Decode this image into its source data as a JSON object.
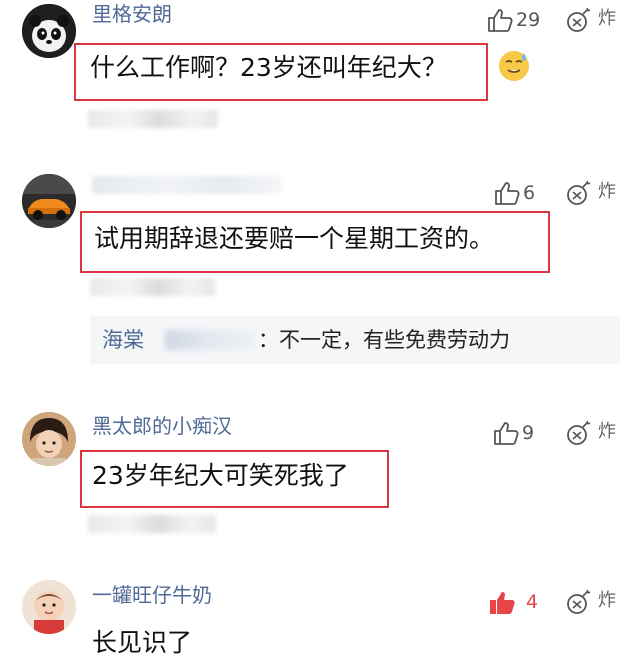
{
  "comments": [
    {
      "username": "里格安朗",
      "likes": "29",
      "bomb_label": "炸",
      "text": "什么工作啊？23岁还叫年纪大？",
      "emoji": "sweat-smile-emoji"
    },
    {
      "username": "",
      "likes": "6",
      "bomb_label": "炸",
      "text": "试用期辞退还要赔一个星期工资的。",
      "reply": {
        "user": "海棠",
        "separator": "：",
        "text": "不一定，有些免费劳动力"
      }
    },
    {
      "username": "黑太郎的小痴汉",
      "likes": "9",
      "bomb_label": "炸",
      "text": "23岁年纪大可笑死我了"
    },
    {
      "username": "一罐旺仔牛奶",
      "likes": "4",
      "liked": true,
      "bomb_label": "炸",
      "text": "长见识了"
    }
  ],
  "colors": {
    "username": "#4f6a94",
    "highlight_border": "#d9363e",
    "liked": "#e8454a",
    "text": "#111111"
  }
}
